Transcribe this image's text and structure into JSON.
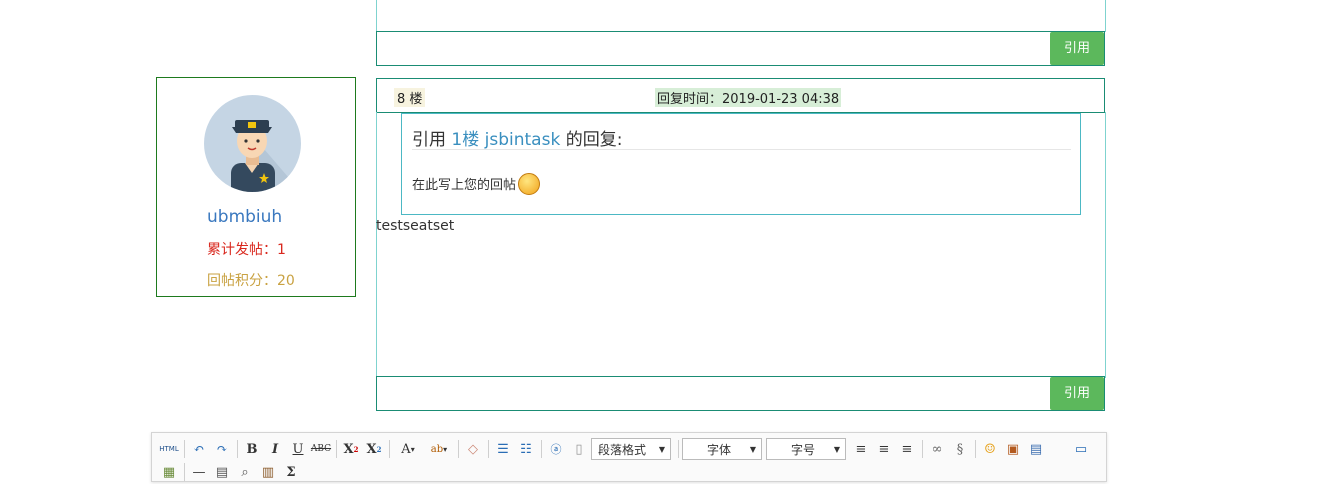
{
  "prev_post": {
    "quote_button": "引用"
  },
  "user": {
    "name": "ubmbiuh",
    "posts_label": "累计发帖：1",
    "score_label": "回帖积分：20"
  },
  "post": {
    "floor": "8 楼",
    "reply_time": "回复时间：2019-01-23 04:38",
    "quote": {
      "prefix": "引用 ",
      "floor_link": "1楼",
      "author_link": "jsbintask",
      "suffix": " 的回复:",
      "text": "在此写上您的回帖"
    },
    "content": "testseatset",
    "quote_button": "引用"
  },
  "editor": {
    "html_label": "HTML",
    "paragraph_select": "段落格式",
    "font_select": "字体",
    "size_select": "字号",
    "icons": [
      "undo-icon",
      "redo-icon",
      "bold-icon",
      "italic-icon",
      "underline-icon",
      "strikethrough-icon",
      "superscript-icon",
      "subscript-icon",
      "font-color-icon",
      "highlight-icon",
      "eraser-icon",
      "ordered-list-icon",
      "unordered-list-icon",
      "blockquote-icon",
      "page-icon",
      "align-left-icon",
      "align-center-icon",
      "align-right-icon",
      "link-icon",
      "unlink-icon",
      "emoticon-icon",
      "image-icon",
      "video-icon",
      "fullscreen-icon",
      "insert-image-icon",
      "horizontal-rule-icon",
      "print-icon",
      "preview-icon",
      "paste-icon",
      "formula-icon"
    ]
  }
}
